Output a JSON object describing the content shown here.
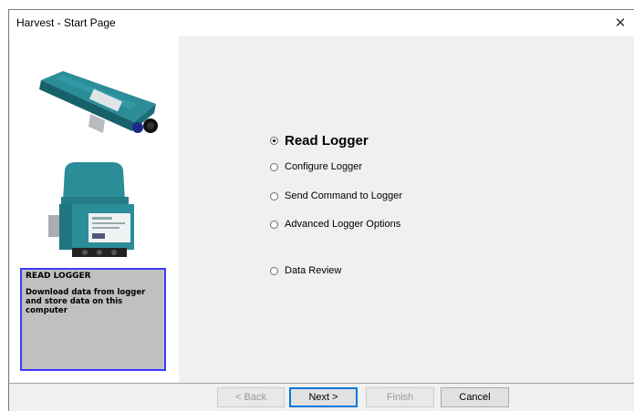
{
  "window": {
    "title": "Harvest - Start Page",
    "close_glyph": "✕"
  },
  "info_panel": {
    "title": "READ LOGGER",
    "description": "Download data from logger and store data on this computer"
  },
  "options": [
    {
      "label": "Read Logger",
      "selected": true
    },
    {
      "label": "Configure Logger",
      "selected": false
    },
    {
      "label": "Send Command to Logger",
      "selected": false
    },
    {
      "label": "Advanced Logger Options",
      "selected": false
    },
    {
      "label": "Data Review",
      "selected": false
    }
  ],
  "buttons": {
    "back": "< Back",
    "next": "Next >",
    "finish": "Finish",
    "cancel": "Cancel"
  },
  "colors": {
    "info_border": "#3c3cff",
    "device_teal": "#1f7d8a"
  }
}
